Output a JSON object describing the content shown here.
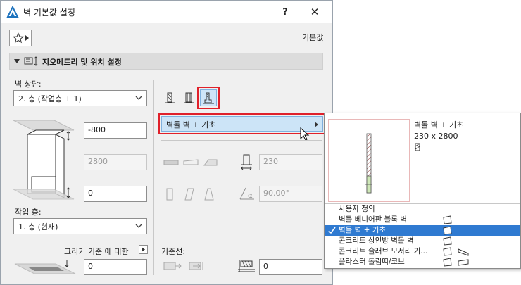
{
  "dialog": {
    "title": "벽 기본값 설정",
    "help_label": "?",
    "close_label": "✕",
    "defaults_label": "기본값"
  },
  "section": {
    "title": "지오메트리 및 위치 설정"
  },
  "left": {
    "wall_top_label": "벽 상단:",
    "wall_top_value": "2. 층 (작업층 + 1)",
    "top_offset_value": "-800",
    "height_value": "2800",
    "bottom_offset_value": "0",
    "home_story_label": "작업 층:",
    "home_story_value": "1. 층 (현재)",
    "drawing_ref_label": "그리기 기준 에 대한",
    "drawing_ref_value": "0"
  },
  "middle": {
    "structure_menu_label": "벽돌 벽 + 기초",
    "thickness_value": "230",
    "angle_value": "90.00°",
    "ref_line_label": "기준선:",
    "ref_offset_value": "0"
  },
  "popup": {
    "preview_name": "벽돌 벽 + 기초",
    "preview_size": "230 x 2800",
    "items": [
      {
        "label": "사용자 정의",
        "selected": false,
        "icon": ""
      },
      {
        "label": "벽돌 베니어판 블록 벽",
        "selected": false,
        "icon": "wall-profile-icon"
      },
      {
        "label": "벽돌 벽 + 기초",
        "selected": true,
        "icon": "wall-profile-icon"
      },
      {
        "label": "콘크리트 상인방 벽돌 벽",
        "selected": false,
        "icon": "wall-profile-icon"
      },
      {
        "label": "콘크리트 슬래브 모서리 기...",
        "selected": false,
        "icon": "slab-edge-icon"
      },
      {
        "label": "플라스터 돌림띠/코브",
        "selected": false,
        "icon": "cornice-icon"
      }
    ]
  },
  "colors": {
    "highlight_red": "#e0202a",
    "selection_blue": "#2f7ad1",
    "menu_blue": "#cce4f7"
  }
}
